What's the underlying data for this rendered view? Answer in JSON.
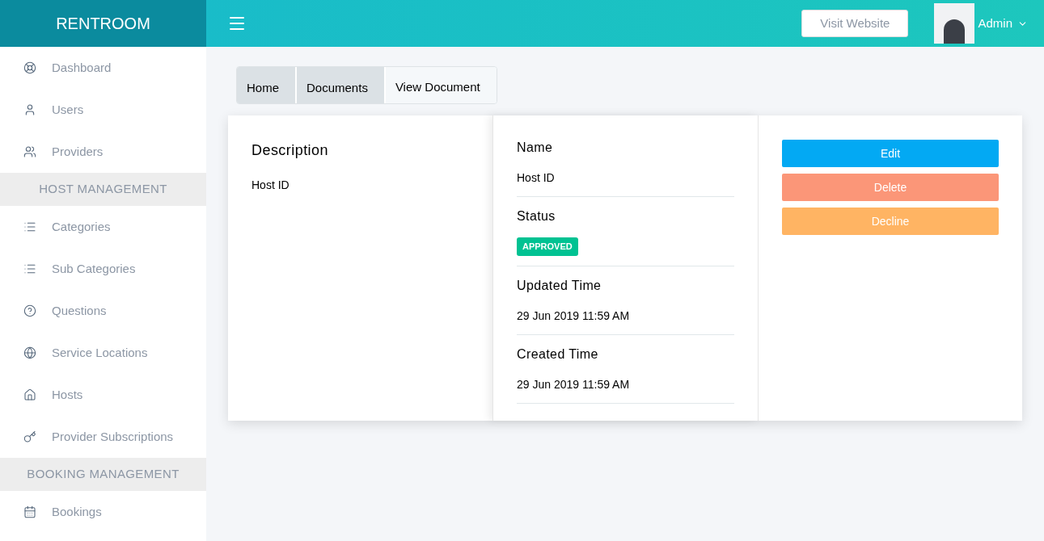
{
  "brand": "RENTROOM",
  "header": {
    "visit_button": "Visit Website",
    "user": "Admin"
  },
  "sidebar": {
    "items": [
      {
        "kind": "item",
        "label": "Dashboard"
      },
      {
        "kind": "item",
        "label": "Users"
      },
      {
        "kind": "item",
        "label": "Providers"
      },
      {
        "kind": "section",
        "label": "HOST MANAGEMENT"
      },
      {
        "kind": "item",
        "label": "Categories"
      },
      {
        "kind": "item",
        "label": "Sub Categories"
      },
      {
        "kind": "item",
        "label": "Questions"
      },
      {
        "kind": "item",
        "label": "Service Locations"
      },
      {
        "kind": "item",
        "label": "Hosts"
      },
      {
        "kind": "item",
        "label": "Provider Subscriptions"
      },
      {
        "kind": "section",
        "label": "BOOKING MANAGEMENT"
      },
      {
        "kind": "item",
        "label": "Bookings"
      }
    ]
  },
  "breadcrumb": [
    {
      "label": "Home",
      "selected": false
    },
    {
      "label": "Documents",
      "selected": false
    },
    {
      "label": "View Document",
      "selected": true
    }
  ],
  "description": {
    "title": "Description",
    "text": "Host ID"
  },
  "details": [
    {
      "label": "Name",
      "kind": "text",
      "value": "Host ID"
    },
    {
      "label": "Status",
      "kind": "badge",
      "value": "APPROVED"
    },
    {
      "label": "Updated Time",
      "kind": "text",
      "value": "29 Jun 2019 11:59 AM"
    },
    {
      "label": "Created Time",
      "kind": "text",
      "value": "29 Jun 2019 11:59 AM"
    }
  ],
  "actions": [
    {
      "kind": "edit",
      "label": "Edit"
    },
    {
      "kind": "delete",
      "label": "Delete"
    },
    {
      "kind": "decline",
      "label": "Decline"
    }
  ]
}
